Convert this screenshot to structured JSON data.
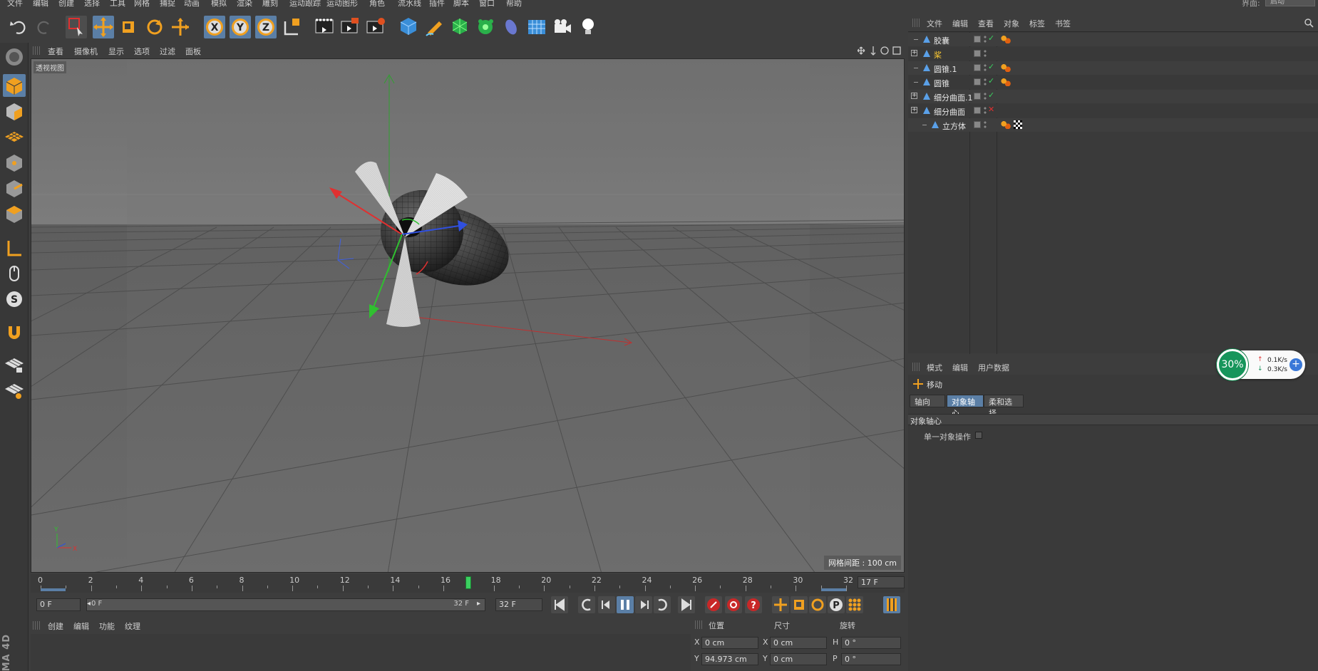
{
  "menu": [
    "文件",
    "编辑",
    "创建",
    "选择",
    "工具",
    "网格",
    "捕捉",
    "动画",
    "模拟",
    "渲染",
    "雕刻",
    "运动跟踪",
    "运动图形",
    "角色",
    "流水线",
    "插件",
    "脚本",
    "窗口",
    "帮助"
  ],
  "layout": {
    "label": "界面:",
    "value": "启动"
  },
  "viewport": {
    "menu": [
      "查看",
      "摄像机",
      "显示",
      "选项",
      "过滤",
      "面板"
    ],
    "view_label": "透视视图",
    "grid_spacing": "网格间距 : 100 cm",
    "axis_y": "Y",
    "axis_x": "X"
  },
  "timeline": {
    "ticks": [
      "0",
      "2",
      "4",
      "6",
      "8",
      "10",
      "12",
      "14",
      "16",
      "18",
      "20",
      "22",
      "24",
      "26",
      "28",
      "30",
      "32"
    ],
    "current_frame": "17 F",
    "playhead_frame": 17,
    "max_frame": 32
  },
  "playback": {
    "start": "0 F",
    "range_start": "0 F",
    "range_end": "32 F",
    "end": "32 F"
  },
  "material": {
    "menu": [
      "创建",
      "编辑",
      "功能",
      "纹理"
    ]
  },
  "coords": {
    "headers": [
      "位置",
      "尺寸",
      "旋转"
    ],
    "rows": [
      {
        "a": "X",
        "pos": "0 cm",
        "b": "X",
        "size": "0 cm",
        "c": "H",
        "rot": "0 °"
      },
      {
        "a": "Y",
        "pos": "94.973 cm",
        "b": "Y",
        "size": "0 cm",
        "c": "P",
        "rot": "0 °"
      }
    ]
  },
  "objects": {
    "menu": [
      "文件",
      "编辑",
      "查看",
      "对象",
      "标签",
      "书签"
    ],
    "items": [
      {
        "name": "胶囊",
        "color": "#e8e8e8",
        "check": "green",
        "tag": true,
        "depth": 0
      },
      {
        "name": "桨",
        "color": "#ffcc33",
        "check": "none",
        "tag": false,
        "depth": 0,
        "expand": true
      },
      {
        "name": "圆锥.1",
        "color": "#e8e8e8",
        "check": "green",
        "tag": true,
        "depth": 0
      },
      {
        "name": "圆锥",
        "color": "#e8e8e8",
        "check": "green",
        "tag": true,
        "depth": 0
      },
      {
        "name": "细分曲面.1",
        "color": "#e8e8e8",
        "check": "green",
        "tag": false,
        "depth": 0,
        "expand": true
      },
      {
        "name": "细分曲面",
        "color": "#e8e8e8",
        "check": "red",
        "tag": false,
        "depth": 0,
        "expand": true
      },
      {
        "name": "立方体",
        "color": "#e8e8e8",
        "check": "none",
        "tag": true,
        "checker": true,
        "depth": 1
      }
    ]
  },
  "attributes": {
    "menu": [
      "模式",
      "编辑",
      "用户数据"
    ],
    "tool": "移动",
    "tabs": [
      "轴向",
      "对象轴心",
      "柔和选择"
    ],
    "active_tab": "对象轴心",
    "section": "对象轴心",
    "option": "单一对象操作"
  },
  "network": {
    "percent": "30%",
    "up": "0.1K/s",
    "down": "0.3K/s"
  },
  "colors": {
    "accent": "#f0a020",
    "axis_x": "#e03030",
    "axis_y": "#30c030",
    "axis_z": "#3050e0",
    "selection": "#5b7fa6"
  }
}
